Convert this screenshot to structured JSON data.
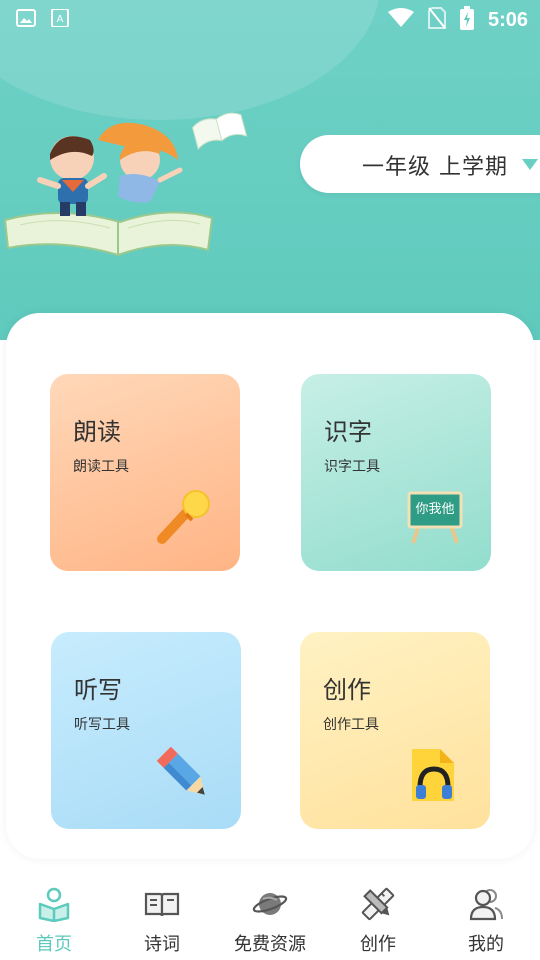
{
  "status_bar": {
    "time": "5:06",
    "icons": [
      "image-icon",
      "text-icon",
      "wifi-icon",
      "no-sim-icon",
      "battery-charging-icon"
    ]
  },
  "header": {
    "semester_label": "一年级  上学期",
    "accent_color": "#5fcabd"
  },
  "tools": [
    {
      "title": "朗读",
      "subtitle": "朗读工具",
      "icon": "microphone-icon"
    },
    {
      "title": "识字",
      "subtitle": "识字工具",
      "icon": "blackboard-icon",
      "icon_text": "你我他"
    },
    {
      "title": "听写",
      "subtitle": "听写工具",
      "icon": "pencil-icon"
    },
    {
      "title": "创作",
      "subtitle": "创作工具",
      "icon": "audio-file-icon"
    }
  ],
  "bottom_nav": [
    {
      "label": "首页",
      "icon": "reader-icon",
      "active": true
    },
    {
      "label": "诗词",
      "icon": "book-icon",
      "active": false
    },
    {
      "label": "免费资源",
      "icon": "planet-icon",
      "active": false
    },
    {
      "label": "创作",
      "icon": "pen-ruler-icon",
      "active": false
    },
    {
      "label": "我的",
      "icon": "user-icon",
      "active": false
    }
  ]
}
